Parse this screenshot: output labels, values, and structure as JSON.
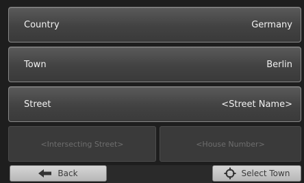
{
  "fields": {
    "country": {
      "label": "Country",
      "value": "Germany"
    },
    "town": {
      "label": "Town",
      "value": "Berlin"
    },
    "street": {
      "label": "Street",
      "value": "<Street Name>"
    }
  },
  "disabled_fields": {
    "intersecting_street": "<Intersecting Street>",
    "house_number": "<House Number>"
  },
  "buttons": {
    "back": {
      "label": "Back",
      "icon": "arrow-left-icon"
    },
    "select_town": {
      "label": "Select Town",
      "icon": "crosshair-icon"
    }
  },
  "colors": {
    "field_text": "#f2f2f2",
    "disabled_text": "#6e6e6e",
    "button_text": "#3a3a3a"
  }
}
